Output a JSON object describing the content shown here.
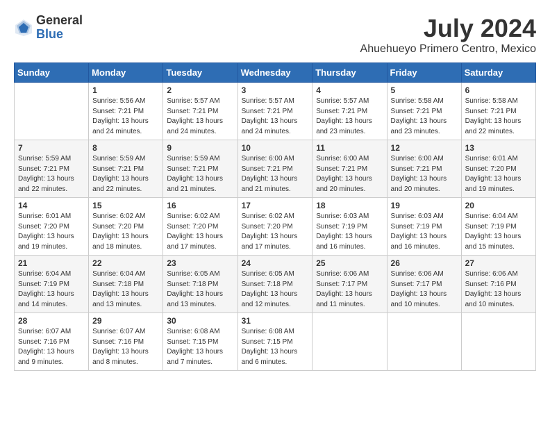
{
  "header": {
    "logo_general": "General",
    "logo_blue": "Blue",
    "month_title": "July 2024",
    "location": "Ahuehueyo Primero Centro, Mexico"
  },
  "weekdays": [
    "Sunday",
    "Monday",
    "Tuesday",
    "Wednesday",
    "Thursday",
    "Friday",
    "Saturday"
  ],
  "weeks": [
    [
      {
        "day": "",
        "info": ""
      },
      {
        "day": "1",
        "info": "Sunrise: 5:56 AM\nSunset: 7:21 PM\nDaylight: 13 hours\nand 24 minutes."
      },
      {
        "day": "2",
        "info": "Sunrise: 5:57 AM\nSunset: 7:21 PM\nDaylight: 13 hours\nand 24 minutes."
      },
      {
        "day": "3",
        "info": "Sunrise: 5:57 AM\nSunset: 7:21 PM\nDaylight: 13 hours\nand 24 minutes."
      },
      {
        "day": "4",
        "info": "Sunrise: 5:57 AM\nSunset: 7:21 PM\nDaylight: 13 hours\nand 23 minutes."
      },
      {
        "day": "5",
        "info": "Sunrise: 5:58 AM\nSunset: 7:21 PM\nDaylight: 13 hours\nand 23 minutes."
      },
      {
        "day": "6",
        "info": "Sunrise: 5:58 AM\nSunset: 7:21 PM\nDaylight: 13 hours\nand 22 minutes."
      }
    ],
    [
      {
        "day": "7",
        "info": "Sunrise: 5:59 AM\nSunset: 7:21 PM\nDaylight: 13 hours\nand 22 minutes."
      },
      {
        "day": "8",
        "info": "Sunrise: 5:59 AM\nSunset: 7:21 PM\nDaylight: 13 hours\nand 22 minutes."
      },
      {
        "day": "9",
        "info": "Sunrise: 5:59 AM\nSunset: 7:21 PM\nDaylight: 13 hours\nand 21 minutes."
      },
      {
        "day": "10",
        "info": "Sunrise: 6:00 AM\nSunset: 7:21 PM\nDaylight: 13 hours\nand 21 minutes."
      },
      {
        "day": "11",
        "info": "Sunrise: 6:00 AM\nSunset: 7:21 PM\nDaylight: 13 hours\nand 20 minutes."
      },
      {
        "day": "12",
        "info": "Sunrise: 6:00 AM\nSunset: 7:21 PM\nDaylight: 13 hours\nand 20 minutes."
      },
      {
        "day": "13",
        "info": "Sunrise: 6:01 AM\nSunset: 7:20 PM\nDaylight: 13 hours\nand 19 minutes."
      }
    ],
    [
      {
        "day": "14",
        "info": "Sunrise: 6:01 AM\nSunset: 7:20 PM\nDaylight: 13 hours\nand 19 minutes."
      },
      {
        "day": "15",
        "info": "Sunrise: 6:02 AM\nSunset: 7:20 PM\nDaylight: 13 hours\nand 18 minutes."
      },
      {
        "day": "16",
        "info": "Sunrise: 6:02 AM\nSunset: 7:20 PM\nDaylight: 13 hours\nand 17 minutes."
      },
      {
        "day": "17",
        "info": "Sunrise: 6:02 AM\nSunset: 7:20 PM\nDaylight: 13 hours\nand 17 minutes."
      },
      {
        "day": "18",
        "info": "Sunrise: 6:03 AM\nSunset: 7:19 PM\nDaylight: 13 hours\nand 16 minutes."
      },
      {
        "day": "19",
        "info": "Sunrise: 6:03 AM\nSunset: 7:19 PM\nDaylight: 13 hours\nand 16 minutes."
      },
      {
        "day": "20",
        "info": "Sunrise: 6:04 AM\nSunset: 7:19 PM\nDaylight: 13 hours\nand 15 minutes."
      }
    ],
    [
      {
        "day": "21",
        "info": "Sunrise: 6:04 AM\nSunset: 7:19 PM\nDaylight: 13 hours\nand 14 minutes."
      },
      {
        "day": "22",
        "info": "Sunrise: 6:04 AM\nSunset: 7:18 PM\nDaylight: 13 hours\nand 13 minutes."
      },
      {
        "day": "23",
        "info": "Sunrise: 6:05 AM\nSunset: 7:18 PM\nDaylight: 13 hours\nand 13 minutes."
      },
      {
        "day": "24",
        "info": "Sunrise: 6:05 AM\nSunset: 7:18 PM\nDaylight: 13 hours\nand 12 minutes."
      },
      {
        "day": "25",
        "info": "Sunrise: 6:06 AM\nSunset: 7:17 PM\nDaylight: 13 hours\nand 11 minutes."
      },
      {
        "day": "26",
        "info": "Sunrise: 6:06 AM\nSunset: 7:17 PM\nDaylight: 13 hours\nand 10 minutes."
      },
      {
        "day": "27",
        "info": "Sunrise: 6:06 AM\nSunset: 7:16 PM\nDaylight: 13 hours\nand 10 minutes."
      }
    ],
    [
      {
        "day": "28",
        "info": "Sunrise: 6:07 AM\nSunset: 7:16 PM\nDaylight: 13 hours\nand 9 minutes."
      },
      {
        "day": "29",
        "info": "Sunrise: 6:07 AM\nSunset: 7:16 PM\nDaylight: 13 hours\nand 8 minutes."
      },
      {
        "day": "30",
        "info": "Sunrise: 6:08 AM\nSunset: 7:15 PM\nDaylight: 13 hours\nand 7 minutes."
      },
      {
        "day": "31",
        "info": "Sunrise: 6:08 AM\nSunset: 7:15 PM\nDaylight: 13 hours\nand 6 minutes."
      },
      {
        "day": "",
        "info": ""
      },
      {
        "day": "",
        "info": ""
      },
      {
        "day": "",
        "info": ""
      }
    ]
  ]
}
